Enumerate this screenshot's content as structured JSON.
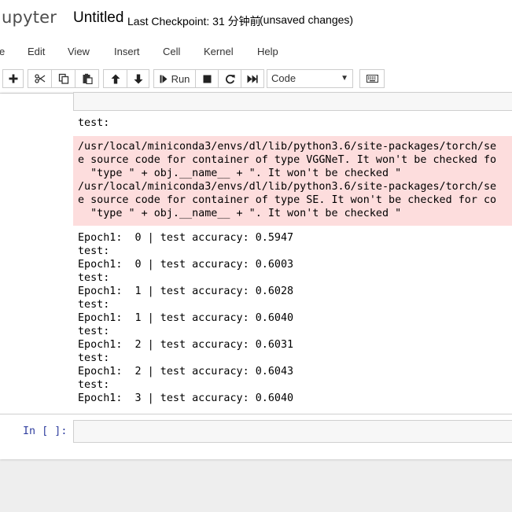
{
  "header": {
    "logo_text": "jupyter",
    "notebook_title": "Untitled",
    "checkpoint": "Last Checkpoint: 31 分钟前",
    "save_status": "(unsaved changes)"
  },
  "menu": {
    "items": [
      "e",
      "Edit",
      "View",
      "Insert",
      "Cell",
      "Kernel",
      "Help"
    ]
  },
  "toolbar": {
    "buttons": [
      {
        "name": "insert-cell",
        "icon": "plus-icon"
      },
      {
        "name": "cut",
        "icon": "scissors-icon"
      },
      {
        "name": "copy",
        "icon": "copy-icon"
      },
      {
        "name": "paste",
        "icon": "paste-icon"
      },
      {
        "name": "move-up",
        "icon": "arrow-up-icon"
      },
      {
        "name": "move-down",
        "icon": "arrow-down-icon"
      },
      {
        "name": "run",
        "icon": "step-forward-icon"
      },
      {
        "name": "interrupt",
        "icon": "stop-icon"
      },
      {
        "name": "restart",
        "icon": "refresh-icon"
      },
      {
        "name": "restart-run-all",
        "icon": "fast-forward-icon"
      },
      {
        "name": "command-palette",
        "icon": "keyboard-icon"
      }
    ],
    "run_label": "Run",
    "cell_type": "Code",
    "cell_type_caret": "▼"
  },
  "output": {
    "test_line_top": "test:",
    "stderr": "/usr/local/miniconda3/envs/dl/lib/python3.6/site-packages/torch/se\ne source code for container of type VGGNeT. It won't be checked fo\n  \"type \" + obj.__name__ + \". It won't be checked \"\n/usr/local/miniconda3/envs/dl/lib/python3.6/site-packages/torch/se\ne source code for container of type SE. It won't be checked for co\n  \"type \" + obj.__name__ + \". It won't be checked \"",
    "stdout": "Epoch1:  0 | test accuracy: 0.5947\ntest:\nEpoch1:  0 | test accuracy: 0.6003\ntest:\nEpoch1:  1 | test accuracy: 0.6028\ntest:\nEpoch1:  1 | test accuracy: 0.6040\ntest:\nEpoch1:  2 | test accuracy: 0.6031\ntest:\nEpoch1:  2 | test accuracy: 0.6043\ntest:\nEpoch1:  3 | test accuracy: 0.6040"
  },
  "next_cell": {
    "prompt": "In [ ]:"
  },
  "colors": {
    "stderr_background": "#fddddd",
    "prompt_color": "#303f9f",
    "logo_color": "#4d4d4d"
  }
}
